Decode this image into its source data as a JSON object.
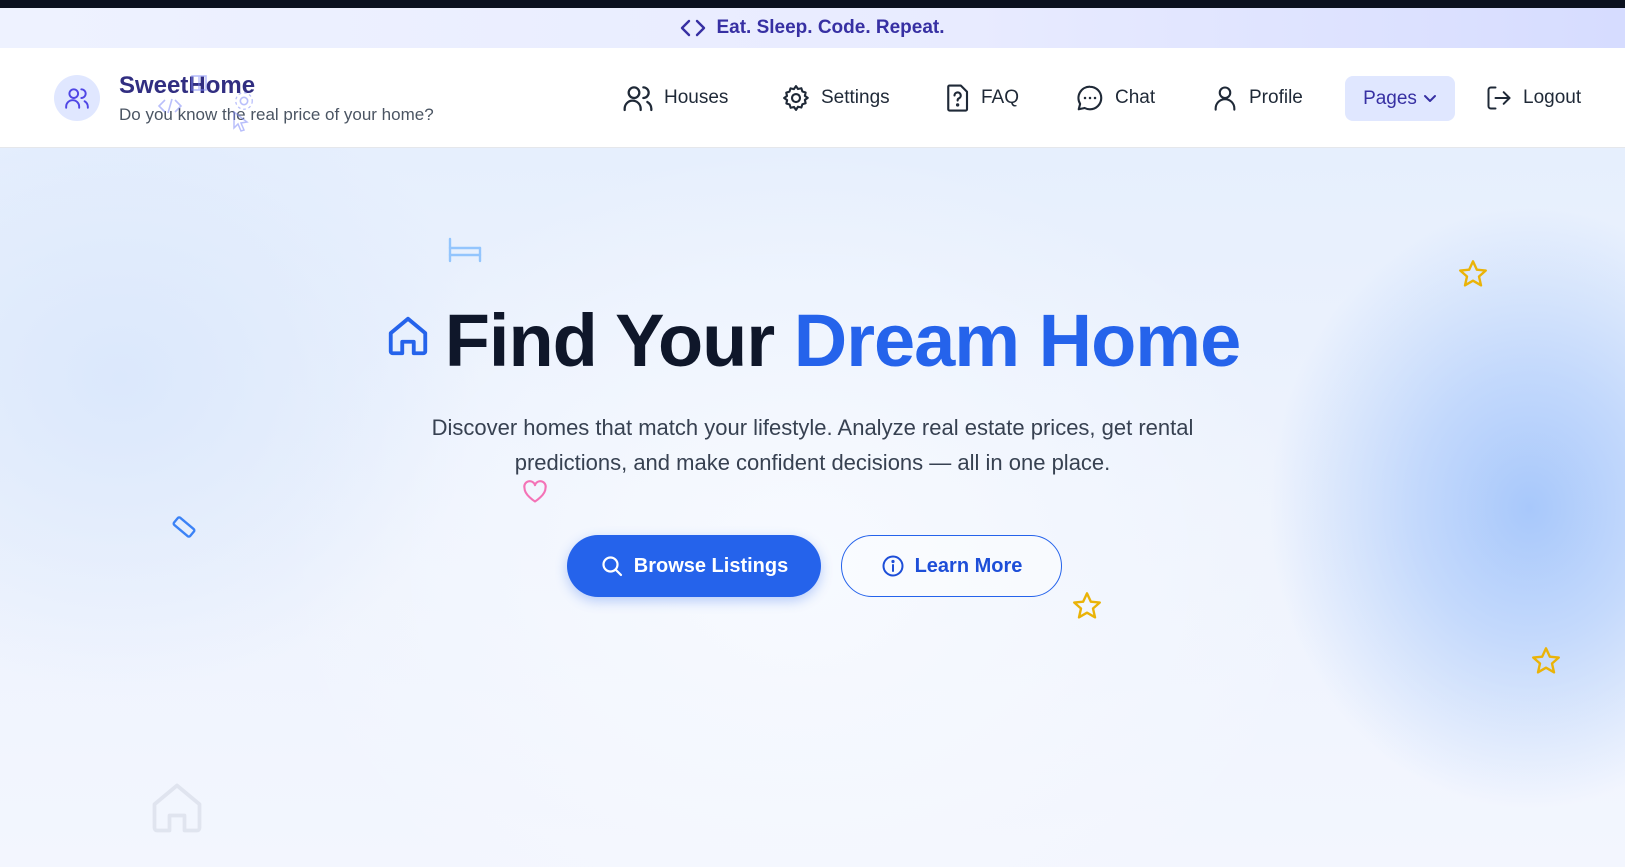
{
  "banner": {
    "text": "Eat. Sleep. Code. Repeat.",
    "icon": "code-brackets-icon"
  },
  "brand": {
    "title": "SweetHome",
    "subtitle": "Do you know the real price of your home?",
    "icon": "users-icon"
  },
  "nav": {
    "items": [
      {
        "label": "Houses",
        "icon": "users-icon"
      },
      {
        "label": "Settings",
        "icon": "gear-icon"
      },
      {
        "label": "FAQ",
        "icon": "file-question-icon"
      },
      {
        "label": "Chat",
        "icon": "chat-bubble-icon"
      },
      {
        "label": "Profile",
        "icon": "user-icon"
      }
    ],
    "pages_label": "Pages",
    "logout_label": "Logout"
  },
  "hero": {
    "title_dark": "Find Your",
    "title_accent": "Dream Home",
    "subtitle_line1": "Discover homes that match your lifestyle. Analyze real estate prices, get rental",
    "subtitle_line2": "predictions, and make confident decisions — all in one place.",
    "primary_button": "Browse Listings",
    "secondary_button": "Learn More"
  },
  "colors": {
    "accent": "#2563eb",
    "brand": "#312e81",
    "star": "#eab308",
    "heart": "#f472b6"
  }
}
